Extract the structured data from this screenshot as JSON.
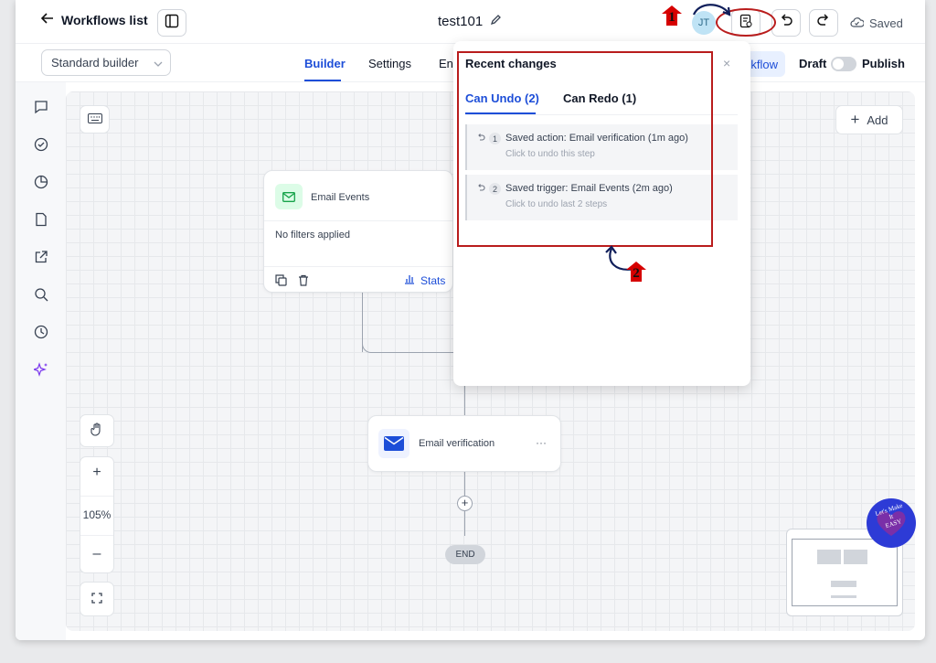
{
  "header": {
    "back_label": "Workflows list",
    "workflow_title": "test101",
    "avatar_initials": "JT",
    "saved_label": "Saved"
  },
  "subbar": {
    "builder_select_value": "Standard builder",
    "tabs": [
      "Builder",
      "Settings",
      "En"
    ],
    "test_label": "kflow",
    "draft_label": "Draft",
    "publish_label": "Publish"
  },
  "canvas": {
    "add_label": "Add",
    "zoom_level": "105%",
    "zoom_in": "+",
    "zoom_out": "–",
    "trigger_node": {
      "title": "Email Events",
      "filters_text": "No filters applied",
      "stats_label": "Stats"
    },
    "action_node": {
      "title": "Email verification",
      "menu": "···"
    },
    "plus_label": "+",
    "end_label": "END"
  },
  "recent_changes": {
    "title": "Recent changes",
    "close": "×",
    "tabs": [
      "Can Undo (2)",
      "Can Redo (1)"
    ],
    "items": [
      {
        "num": "1",
        "title": "Saved action: Email verification (1m ago)",
        "hint": "Click to undo this step"
      },
      {
        "num": "2",
        "title": "Saved trigger: Email Events (2m ago)",
        "hint": "Click to undo last 2 steps"
      }
    ]
  },
  "annotations": {
    "marker_1": "1",
    "marker_2": "2",
    "highlight_color": "#b91c1c"
  },
  "watermark": {
    "line1": "Let's Make",
    "line2": "It",
    "line3": "EASY"
  },
  "colors": {
    "accent": "#1d4ed8",
    "trigger_green": "#16a34a",
    "action_blue": "#1d4ed8"
  }
}
